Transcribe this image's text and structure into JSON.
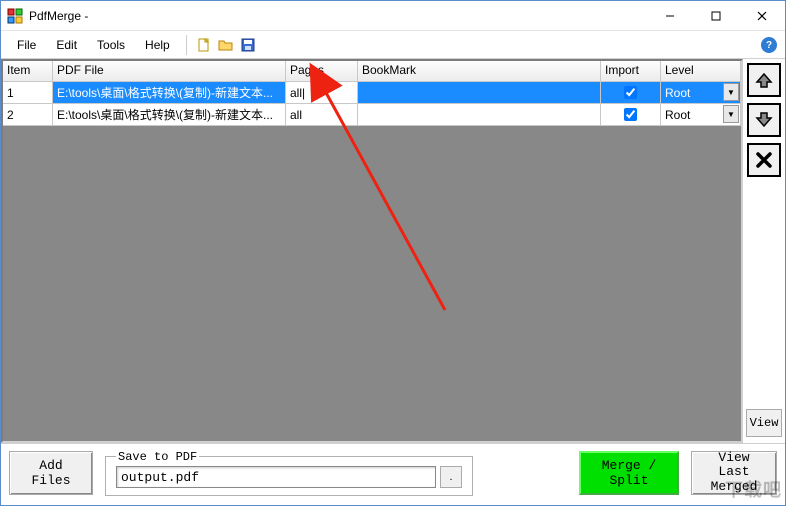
{
  "title": "PdfMerge -",
  "menu": {
    "file": "File",
    "edit": "Edit",
    "tools": "Tools",
    "help": "Help"
  },
  "columns": {
    "item": "Item",
    "file": "PDF File",
    "pages": "Pages",
    "bookmark": "BookMark",
    "import": "Import",
    "level": "Level"
  },
  "rows": [
    {
      "item": "1",
      "file": "E:\\tools\\桌面\\格式转换\\(复制)-新建文本...",
      "pages": "all",
      "bookmark": "",
      "import": true,
      "level": "Root",
      "selected": true,
      "editing_pages": true
    },
    {
      "item": "2",
      "file": "E:\\tools\\桌面\\格式转换\\(复制)-新建文本...",
      "pages": "all",
      "bookmark": "",
      "import": true,
      "level": "Root",
      "selected": false,
      "editing_pages": false
    }
  ],
  "side": {
    "view": "View"
  },
  "bottom": {
    "add_files": "Add Files",
    "save_legend": "Save to PDF",
    "save_value": "output.pdf",
    "browse": ".",
    "merge": "Merge / Split",
    "view_last": "View Last\nMerged"
  },
  "watermark": "下载吧"
}
